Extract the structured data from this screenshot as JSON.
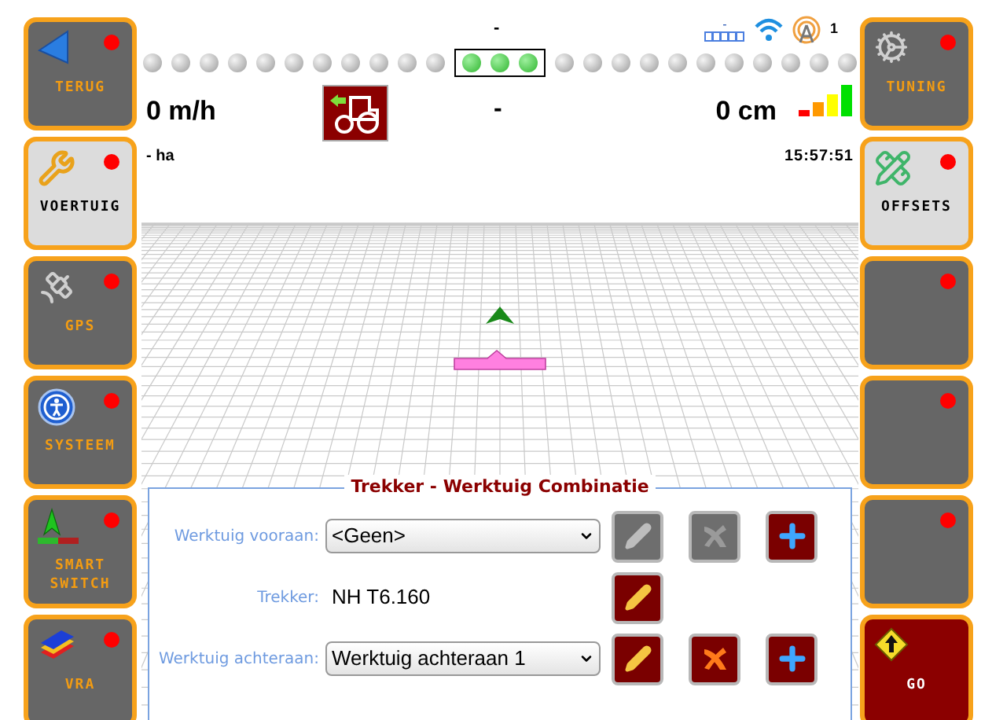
{
  "header": {
    "top_center": "-",
    "gps_quality": "-",
    "satellites": "1",
    "speed": "0 m/h",
    "center_value": "-",
    "offset": "0 cm",
    "area": "- ha",
    "clock": "15:57:51"
  },
  "lightbar": [
    {
      "on": false
    },
    {
      "on": false
    },
    {
      "on": false
    },
    {
      "on": false
    },
    {
      "on": false
    },
    {
      "on": false
    },
    {
      "on": false
    },
    {
      "on": false
    },
    {
      "on": false
    },
    {
      "on": false
    },
    {
      "on": false
    },
    {
      "on": true
    },
    {
      "on": true
    },
    {
      "on": true
    },
    {
      "on": false
    },
    {
      "on": false
    },
    {
      "on": false
    },
    {
      "on": false
    },
    {
      "on": false
    },
    {
      "on": false
    },
    {
      "on": false
    },
    {
      "on": false
    },
    {
      "on": false
    },
    {
      "on": false
    },
    {
      "on": false
    }
  ],
  "left_buttons": [
    {
      "label": "TERUG",
      "kind": "back",
      "selected": false,
      "alert": true
    },
    {
      "label": "VOERTUIG",
      "kind": "wrench",
      "selected": true,
      "alert": true
    },
    {
      "label": "GPS",
      "kind": "satellite",
      "selected": false,
      "alert": true
    },
    {
      "label": "SYSTEEM",
      "kind": "person",
      "selected": false,
      "alert": true
    },
    {
      "label": "SMART\nSWITCH",
      "kind": "switch",
      "selected": false,
      "alert": true
    },
    {
      "label": "VRA",
      "kind": "layers",
      "selected": false,
      "alert": true
    }
  ],
  "right_buttons": [
    {
      "label": "TUNING",
      "kind": "gears",
      "selected": false,
      "alert": true
    },
    {
      "label": "OFFSETS",
      "kind": "ruler",
      "selected": true,
      "alert": true
    },
    {
      "kind": "blank",
      "selected": false,
      "alert": true
    },
    {
      "kind": "blank",
      "selected": false,
      "alert": true
    },
    {
      "kind": "blank",
      "selected": false,
      "alert": true
    },
    {
      "label": "GO",
      "kind": "go",
      "alert": false
    }
  ],
  "panel": {
    "title": "Trekker - Werktuig Combinatie",
    "rows": [
      {
        "label": "Werktuig vooraan:",
        "kind": "select",
        "value": "<Geen>",
        "actions": [
          {
            "kind": "edit",
            "disabled": true
          },
          {
            "kind": "delete",
            "disabled": true
          },
          {
            "kind": "add",
            "disabled": false
          }
        ]
      },
      {
        "label": "Trekker:",
        "kind": "text",
        "value": "NH T6.160",
        "actions": [
          {
            "kind": "edit",
            "disabled": false
          }
        ]
      },
      {
        "label": "Werktuig achteraan:",
        "kind": "select",
        "value": "Werktuig achteraan 1",
        "actions": [
          {
            "kind": "edit",
            "disabled": false
          },
          {
            "kind": "delete",
            "disabled": false
          },
          {
            "kind": "add",
            "disabled": false
          }
        ]
      }
    ]
  }
}
